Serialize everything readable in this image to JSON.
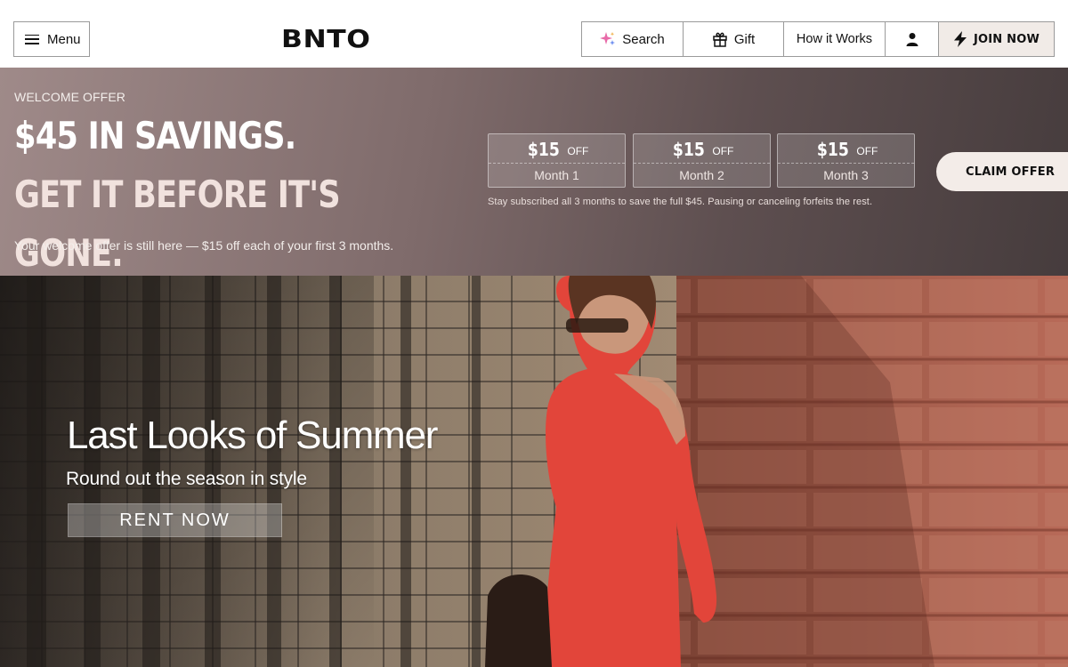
{
  "header": {
    "menu_label": "Menu",
    "logo": "BNTO",
    "nav": {
      "search_label": "Search",
      "gift_label": "Gift",
      "how_label": "How it Works",
      "join_label": "JOIN NOW"
    }
  },
  "banner": {
    "eyebrow": "WELCOME OFFER",
    "headline_part1": "$45 IN SAVINGS.",
    "headline_part2": "GET IT BEFORE IT'S GONE.",
    "subtext": "Your welcome offer is still here — $15 off each of your first 3 months.",
    "months": [
      {
        "amount": "$15",
        "off": "OFF",
        "label": "Month 1"
      },
      {
        "amount": "$15",
        "off": "OFF",
        "label": "Month 2"
      },
      {
        "amount": "$15",
        "off": "OFF",
        "label": "Month 3"
      }
    ],
    "fine_print": "Stay subscribed all 3 months to save the full $45.  Pausing or canceling forfeits the rest.",
    "cta_label": "CLAIM OFFER"
  },
  "hero": {
    "title": "Last Looks of Summer",
    "subtitle": "Round out the season in style",
    "cta_label": "RENT NOW"
  }
}
